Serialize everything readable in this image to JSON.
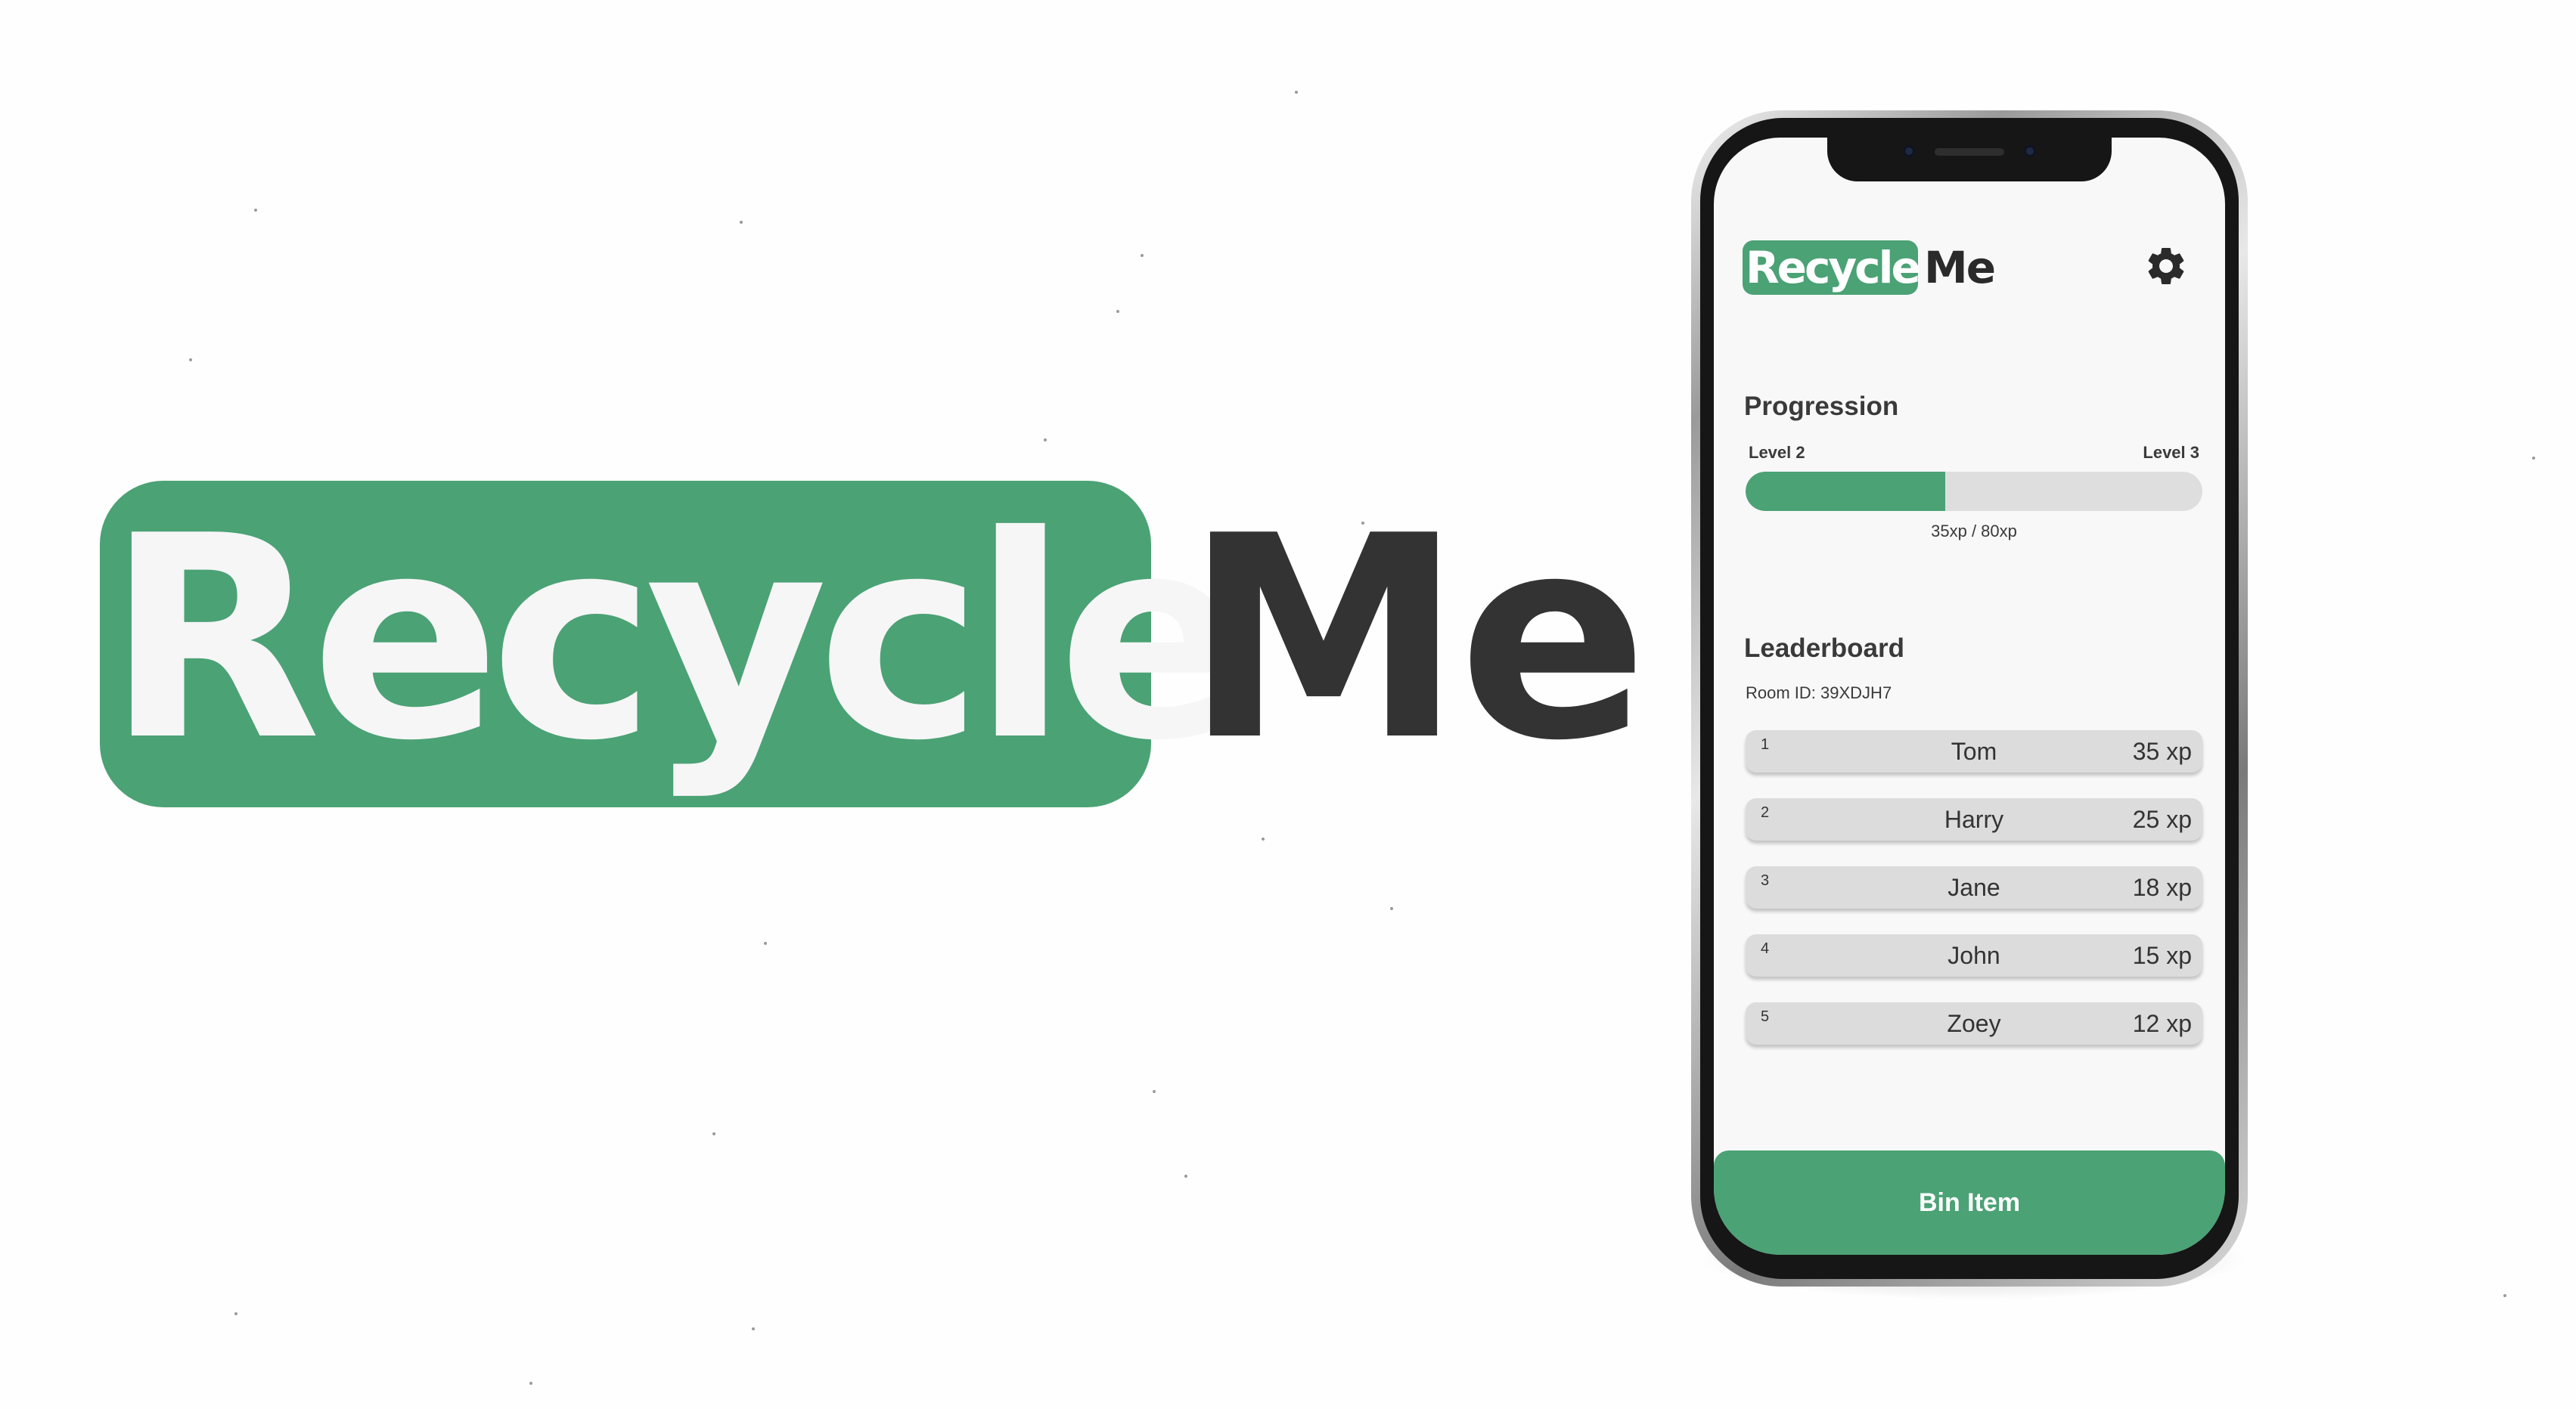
{
  "brand": {
    "name_part1": "Recycle",
    "name_part2": "Me",
    "primary_color": "#4ba275",
    "dark_text_color": "#333333"
  },
  "app": {
    "header": {
      "logo_part1": "Recycle",
      "logo_part2": "Me",
      "settings_icon": "gear-icon"
    },
    "progression": {
      "title": "Progression",
      "current_level_label": "Level 2",
      "next_level_label": "Level 3",
      "xp_current": 35,
      "xp_target": 80,
      "caption": "35xp / 80xp"
    },
    "leaderboard": {
      "title": "Leaderboard",
      "room_id": "Room ID: 39XDJH7",
      "entries": [
        {
          "rank": "1",
          "name": "Tom",
          "xp": "35 xp"
        },
        {
          "rank": "2",
          "name": "Harry",
          "xp": "25 xp"
        },
        {
          "rank": "3",
          "name": "Jane",
          "xp": "18 xp"
        },
        {
          "rank": "4",
          "name": "John",
          "xp": "15 xp"
        },
        {
          "rank": "5",
          "name": "Zoey",
          "xp": "12 xp"
        }
      ]
    },
    "bin_button_label": "Bin Item"
  }
}
